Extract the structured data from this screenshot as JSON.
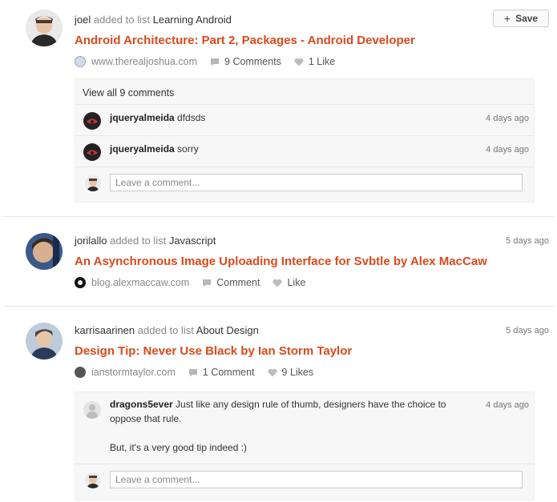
{
  "save_button": {
    "icon": "plus-icon",
    "label": "Save"
  },
  "stories": [
    {
      "user": "joel",
      "action": "added to list",
      "list": "Learning Android",
      "title": "Android Architecture: Part 2, Packages - Android Developer",
      "site": "www.therealjoshua.com",
      "comments_label": "9 Comments",
      "likes_label": "1 Like",
      "view_all": "View all 9 comments",
      "comments": [
        {
          "user": "jqueryalmeida",
          "text": "dfdsds",
          "time": "4 days ago"
        },
        {
          "user": "jqueryalmeida",
          "text": "sorry",
          "time": "4 days ago"
        }
      ],
      "reply_placeholder": "Leave a comment..."
    },
    {
      "user": "jorilallo",
      "action": "added to list",
      "list": "Javascript",
      "time": "5 days ago",
      "title": "An Asynchronous Image Uploading Interface for Svbtle by Alex MacCaw",
      "site": "blog.alexmaccaw.com",
      "comments_label": "Comment",
      "likes_label": "Like"
    },
    {
      "user": "karrisaarinen",
      "action": "added to list",
      "list": "About Design",
      "time": "5 days ago",
      "title": "Design Tip: Never Use Black by Ian Storm Taylor",
      "site": "ianstormtaylor.com",
      "comments_label": "1 Comment",
      "likes_label": "9 Likes",
      "comments": [
        {
          "user": "dragons5ever",
          "text": "Just like any design rule of thumb, designers have the choice to",
          "text2": "oppose that rule.",
          "text3": "But, it's a very good tip indeed :)",
          "time": "4 days ago"
        }
      ],
      "reply_placeholder": "Leave a comment..."
    }
  ],
  "colors": {
    "title": "#d94a1d",
    "muted": "#888888",
    "panel": "#f7f7f7"
  }
}
